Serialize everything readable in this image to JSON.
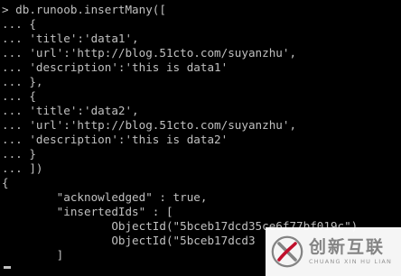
{
  "terminal": {
    "lines": [
      "> db.runoob.insertMany([",
      "... {",
      "... 'title':'data1',",
      "... 'url':'http://blog.51cto.com/suyanzhu',",
      "... 'description':'this is data1'",
      "... },",
      "... {",
      "... 'title':'data2',",
      "... 'url':'http://blog.51cto.com/suyanzhu',",
      "... 'description':'this is data2'",
      "... }",
      "... ])",
      "{",
      "        \"acknowledged\" : true,",
      "        \"insertedIds\" : [",
      "                ObjectId(\"5bceb17dcd35ce6f77bf019c\")",
      "                ObjectId(\"5bceb17dcd3",
      "        ]",
      ""
    ]
  },
  "watermark": {
    "brand_cn": "创新互联",
    "brand_pinyin": "CHUANG XIN HU LIAN",
    "logo_icon": "swirl-x-logo"
  },
  "colors": {
    "background": "#000000",
    "text": "#c0c0c0",
    "watermark_bg": "#ffffff",
    "watermark_text": "#8a8a8a"
  }
}
